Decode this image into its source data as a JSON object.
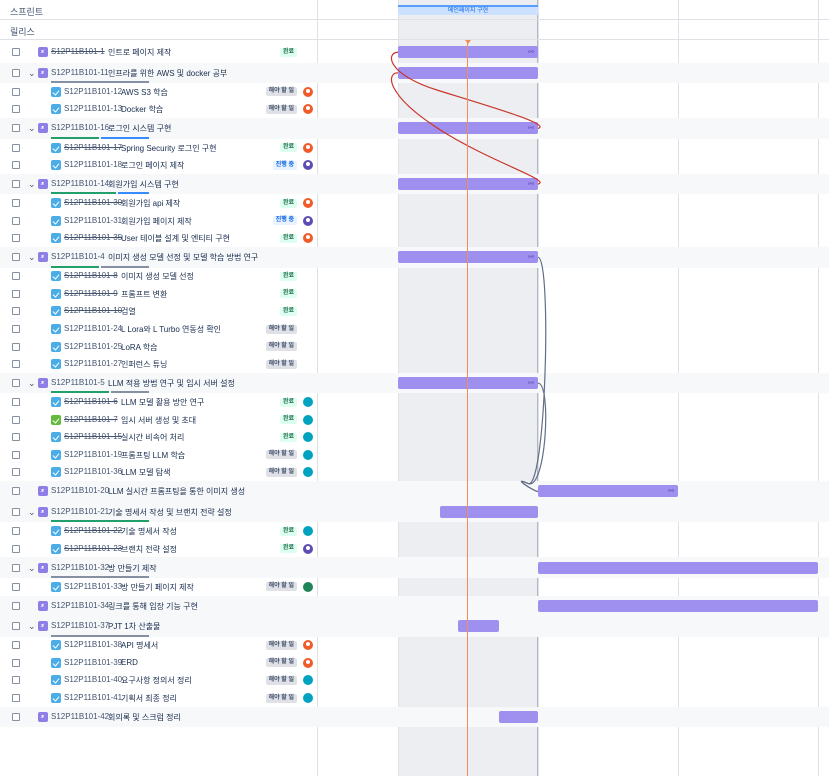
{
  "headers": {
    "sprints": "스프린트",
    "releases": "릴리스",
    "sprint_band": "메인페이지 구현"
  },
  "rows": [
    {
      "key": "S12P11B101-1",
      "summary": "인트로 페이지 제작",
      "type": "epic",
      "child": false,
      "band": false,
      "done": true,
      "status": "완료",
      "status_kind": "done",
      "avatar": "",
      "bar": [
        0,
        1
      ],
      "bar_link": true
    },
    {
      "key": "S12P11B101-11",
      "summary": "인프라를 위한 AWS 및 docker 공부",
      "type": "epic",
      "child": false,
      "band": true,
      "expand": true,
      "done": false,
      "progress": [
        0,
        0,
        1
      ],
      "bar": [
        0,
        1
      ]
    },
    {
      "key": "S12P11B101-12",
      "summary": "AWS S3 학습",
      "type": "task",
      "child": true,
      "band": false,
      "done": false,
      "status": "해야 할 일",
      "status_kind": "todo",
      "avatar": "red"
    },
    {
      "key": "S12P11B101-13",
      "summary": "Docker 학습",
      "type": "task",
      "child": true,
      "band": false,
      "done": false,
      "status": "해야 할 일",
      "status_kind": "todo",
      "avatar": "red"
    },
    {
      "key": "S12P11B101-16",
      "summary": "로그인 시스템 구현",
      "type": "epic",
      "child": false,
      "band": true,
      "expand": true,
      "done": false,
      "progress": [
        0.5,
        0.5,
        0
      ],
      "bar": [
        0,
        1
      ],
      "bar_link": true
    },
    {
      "key": "S12P11B101-17",
      "summary": "Spring Security 로그인 구현",
      "type": "task",
      "child": true,
      "band": false,
      "done": true,
      "status": "완료",
      "status_kind": "done",
      "avatar": "red"
    },
    {
      "key": "S12P11B101-18",
      "summary": "로그인 페이지 제작",
      "type": "task",
      "child": true,
      "band": false,
      "done": false,
      "status": "진행 중",
      "status_kind": "prog",
      "avatar": "indigo"
    },
    {
      "key": "S12P11B101-14",
      "summary": "회원가입 시스템 구현",
      "type": "epic",
      "child": false,
      "band": true,
      "expand": true,
      "done": false,
      "progress": [
        0.67,
        0.33,
        0
      ],
      "bar": [
        0,
        1
      ],
      "bar_link": true
    },
    {
      "key": "S12P11B101-30",
      "summary": "회원가입 api 제작",
      "type": "task",
      "child": true,
      "band": false,
      "done": true,
      "status": "완료",
      "status_kind": "done",
      "avatar": "red"
    },
    {
      "key": "S12P11B101-31",
      "summary": "회원가입 페이지 제작",
      "type": "task",
      "child": true,
      "band": false,
      "done": false,
      "status": "진행 중",
      "status_kind": "prog",
      "avatar": "indigo"
    },
    {
      "key": "S12P11B101-35",
      "summary": "User 테이블 설계 및 엔티티 구현",
      "type": "task",
      "child": true,
      "band": false,
      "done": true,
      "status": "완료",
      "status_kind": "done",
      "avatar": "red"
    },
    {
      "key": "S12P11B101-4",
      "summary": "이미지 생성 모델 선정 및 모델 학습 방법 연구",
      "type": "epic",
      "child": false,
      "band": true,
      "expand": true,
      "done": false,
      "progress": [
        0.5,
        0,
        0.5
      ],
      "bar": [
        0,
        1
      ],
      "bar_link": true
    },
    {
      "key": "S12P11B101-8",
      "summary": "이미지 생성 모델 선정",
      "type": "task",
      "child": true,
      "band": false,
      "done": true,
      "status": "완료",
      "status_kind": "done",
      "avatar": ""
    },
    {
      "key": "S12P11B101-9",
      "summary": "프롬프트 변환",
      "type": "task",
      "child": true,
      "band": false,
      "done": true,
      "status": "완료",
      "status_kind": "done",
      "avatar": ""
    },
    {
      "key": "S12P11B101-10",
      "summary": "검열",
      "type": "task",
      "child": true,
      "band": false,
      "done": true,
      "status": "완료",
      "status_kind": "done",
      "avatar": ""
    },
    {
      "key": "S12P11B101-24",
      "summary": "L Lora와 L Turbo 연동성 확인",
      "type": "task",
      "child": true,
      "band": false,
      "done": false,
      "status": "해야 할 일",
      "status_kind": "todo",
      "avatar": ""
    },
    {
      "key": "S12P11B101-25",
      "summary": "LoRA 학습",
      "type": "task",
      "child": true,
      "band": false,
      "done": false,
      "status": "해야 할 일",
      "status_kind": "todo",
      "avatar": ""
    },
    {
      "key": "S12P11B101-27",
      "summary": "인퍼런스 튜닝",
      "type": "task",
      "child": true,
      "band": false,
      "done": false,
      "status": "해야 할 일",
      "status_kind": "todo",
      "avatar": ""
    },
    {
      "key": "S12P11B101-5",
      "summary": "LLM 적용 방법 연구 및 임시 서버 설정",
      "type": "epic",
      "child": false,
      "band": true,
      "expand": true,
      "done": false,
      "progress": [
        0.6,
        0,
        0.4
      ],
      "bar": [
        0,
        1
      ],
      "bar_link": true
    },
    {
      "key": "S12P11B101-6",
      "summary": "LLM 모델 활용 방안 연구",
      "type": "task",
      "child": true,
      "band": false,
      "done": true,
      "status": "완료",
      "status_kind": "done",
      "avatar": "teal"
    },
    {
      "key": "S12P11B101-7",
      "summary": "임시 서버 생성 및 초대",
      "type": "story",
      "child": true,
      "band": false,
      "done": true,
      "status": "완료",
      "status_kind": "done",
      "avatar": "teal"
    },
    {
      "key": "S12P11B101-15",
      "summary": "실시간 비속어 처리",
      "type": "task",
      "child": true,
      "band": false,
      "done": true,
      "status": "완료",
      "status_kind": "done",
      "avatar": "teal"
    },
    {
      "key": "S12P11B101-19",
      "summary": "프롬프팅 LLM 학습",
      "type": "task",
      "child": true,
      "band": false,
      "done": false,
      "status": "해야 할 일",
      "status_kind": "todo",
      "avatar": "teal"
    },
    {
      "key": "S12P11B101-36",
      "summary": "LLM 모델 탐색",
      "type": "task",
      "child": true,
      "band": false,
      "done": false,
      "status": "해야 할 일",
      "status_kind": "todo",
      "avatar": "teal"
    },
    {
      "key": "S12P11B101-20",
      "summary": "LLM 실시간 프롬프팅을 통한 이미지 생성",
      "type": "epic",
      "child": false,
      "band": true,
      "done": false,
      "bar": [
        1,
        2
      ],
      "bar_link": true
    },
    {
      "key": "S12P11B101-21",
      "summary": "기술 명세서 작성 및 브랜치 전략 설정",
      "type": "epic",
      "child": false,
      "band": true,
      "expand": true,
      "done": false,
      "progress": [
        1,
        0,
        0
      ],
      "bar": [
        0.3,
        1
      ]
    },
    {
      "key": "S12P11B101-22",
      "summary": "기술 명세서 작성",
      "type": "task",
      "child": true,
      "band": false,
      "done": true,
      "status": "완료",
      "status_kind": "done",
      "avatar": "teal"
    },
    {
      "key": "S12P11B101-23",
      "summary": "브랜치 전략 설정",
      "type": "task",
      "child": true,
      "band": false,
      "done": true,
      "status": "완료",
      "status_kind": "done",
      "avatar": "indigo"
    },
    {
      "key": "S12P11B101-32",
      "summary": "방 만들기 제작",
      "type": "epic",
      "child": false,
      "band": true,
      "expand": true,
      "done": false,
      "progress": [
        0,
        0,
        1
      ],
      "bar": [
        1,
        3
      ]
    },
    {
      "key": "S12P11B101-33",
      "summary": "방 만들기 페이지 제작",
      "type": "task",
      "child": true,
      "band": false,
      "done": false,
      "status": "해야 할 일",
      "status_kind": "todo",
      "avatar": "green"
    },
    {
      "key": "S12P11B101-34",
      "summary": "링크를 통해 입장 기능 구현",
      "type": "epic",
      "child": false,
      "band": true,
      "done": false,
      "bar": [
        1,
        3
      ]
    },
    {
      "key": "S12P11B101-37",
      "summary": "PJT 1차 산출물",
      "type": "epic",
      "child": false,
      "band": true,
      "expand": true,
      "done": false,
      "progress": [
        0,
        0,
        1
      ],
      "bar": [
        0.43,
        0.72
      ]
    },
    {
      "key": "S12P11B101-38",
      "summary": "API 명세서",
      "type": "task",
      "child": true,
      "band": false,
      "done": false,
      "status": "해야 할 일",
      "status_kind": "todo",
      "avatar": "red"
    },
    {
      "key": "S12P11B101-39",
      "summary": "ERD",
      "type": "task",
      "child": true,
      "band": false,
      "done": false,
      "status": "해야 할 일",
      "status_kind": "todo",
      "avatar": "red"
    },
    {
      "key": "S12P11B101-40",
      "summary": "요구사항 정의서 정리",
      "type": "task",
      "child": true,
      "band": false,
      "done": false,
      "status": "해야 할 일",
      "status_kind": "todo",
      "avatar": "teal"
    },
    {
      "key": "S12P11B101-41",
      "summary": "기획서 최종 정리",
      "type": "task",
      "child": true,
      "band": false,
      "done": false,
      "status": "해야 할 일",
      "status_kind": "todo",
      "avatar": "teal"
    },
    {
      "key": "S12P11B101-42",
      "summary": "회의록 및 스크럼 정리",
      "type": "epic",
      "child": false,
      "band": true,
      "done": false,
      "bar": [
        0.72,
        1
      ]
    }
  ],
  "dependencies": [
    {
      "from": "S12P11B101-1",
      "to": "S12P11B101-16",
      "color": "#c9372c"
    },
    {
      "from": "S12P11B101-11",
      "to": "S12P11B101-14",
      "color": "#c9372c"
    },
    {
      "from": "S12P11B101-4",
      "to": "S12P11B101-20",
      "color": "#626f86"
    },
    {
      "from": "S12P11B101-5",
      "to": "S12P11B101-20",
      "color": "#626f86"
    }
  ]
}
